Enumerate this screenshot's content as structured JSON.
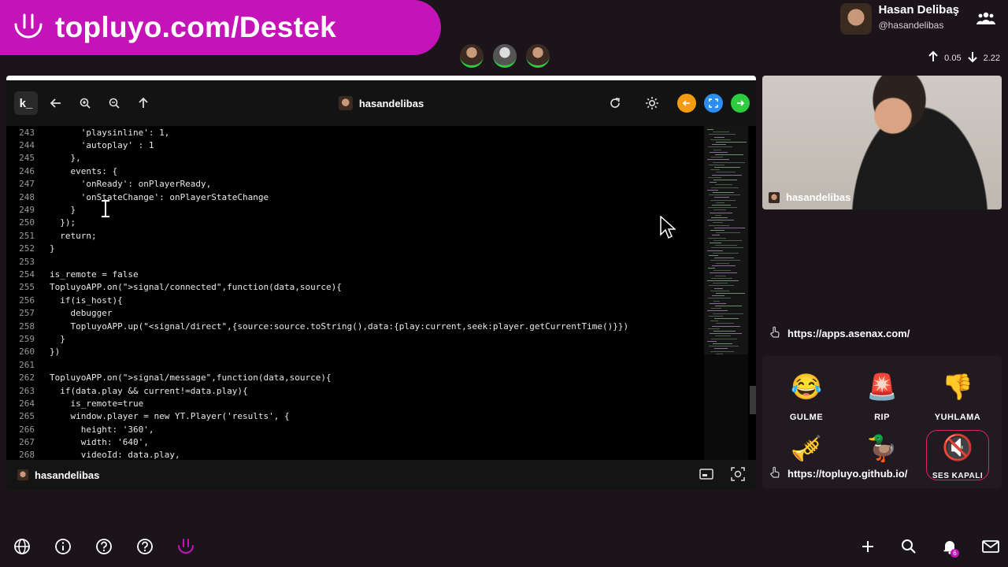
{
  "banner": {
    "text": "topluyo.com/Destek"
  },
  "user": {
    "name": "Hasan Delibaş",
    "handle": "@hasandelibas"
  },
  "net": {
    "up": "0.05",
    "down": "2.22"
  },
  "window": {
    "toolbar_user": "hasandelibas",
    "logo_text": "k_",
    "status_user": "hasandelibas"
  },
  "code": {
    "lines": [
      {
        "n": "243",
        "t": "      'playsinline': 1,"
      },
      {
        "n": "244",
        "t": "      'autoplay' : 1"
      },
      {
        "n": "245",
        "t": "    },"
      },
      {
        "n": "246",
        "t": "    events: {"
      },
      {
        "n": "247",
        "t": "      'onReady': onPlayerReady,"
      },
      {
        "n": "248",
        "t": "      'onStateChange': onPlayerStateChange"
      },
      {
        "n": "249",
        "t": "    }"
      },
      {
        "n": "250",
        "t": "  });"
      },
      {
        "n": "251",
        "t": "  return;"
      },
      {
        "n": "252",
        "t": "}"
      },
      {
        "n": "253",
        "t": ""
      },
      {
        "n": "254",
        "t": "is_remote = false"
      },
      {
        "n": "255",
        "t": "TopluyoAPP.on(\">signal/connected\",function(data,source){"
      },
      {
        "n": "256",
        "t": "  if(is_host){"
      },
      {
        "n": "257",
        "t": "    debugger"
      },
      {
        "n": "258",
        "t": "    TopluyoAPP.up(\"<signal/direct\",{source:source.toString(),data:{play:current,seek:player.getCurrentTime()}})"
      },
      {
        "n": "259",
        "t": "  }"
      },
      {
        "n": "260",
        "t": "})"
      },
      {
        "n": "261",
        "t": ""
      },
      {
        "n": "262",
        "t": "TopluyoAPP.on(\">signal/message\",function(data,source){"
      },
      {
        "n": "263",
        "t": "  if(data.play && current!=data.play){"
      },
      {
        "n": "264",
        "t": "    is_remote=true"
      },
      {
        "n": "265",
        "t": "    window.player = new YT.Player('results', {"
      },
      {
        "n": "266",
        "t": "      height: '360',"
      },
      {
        "n": "267",
        "t": "      width: '640',"
      },
      {
        "n": "268",
        "t": "      videoId: data.play,"
      }
    ]
  },
  "camera": {
    "label": "hasandelibas"
  },
  "links": {
    "top": "https://apps.asenax.com/",
    "bottom": "https://topluyo.github.io/"
  },
  "reactions": [
    {
      "emoji": "😂",
      "label": "GULME"
    },
    {
      "emoji": "🚨",
      "label": "RIP"
    },
    {
      "emoji": "👎",
      "label": "YUHLAMA"
    },
    {
      "emoji": "🎺",
      "label": ""
    },
    {
      "emoji": "🦆",
      "label": ""
    },
    {
      "emoji": "🔇",
      "label": "SES KAPALI"
    }
  ],
  "notifications": {
    "count": "6"
  },
  "colors": {
    "brand": "#c413b8",
    "online": "#2ecc40"
  }
}
